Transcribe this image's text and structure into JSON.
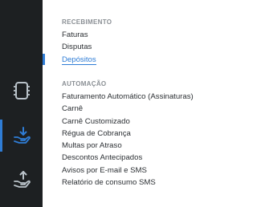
{
  "rail": {
    "items": [
      {
        "icon": "film-strip-icon",
        "active": false
      },
      {
        "icon": "hand-receive-icon",
        "active": true
      },
      {
        "icon": "hand-send-icon",
        "active": false
      }
    ]
  },
  "menu": {
    "sections": [
      {
        "title": "RECEBIMENTO",
        "items": [
          "Faturas",
          "Disputas",
          "Depósitos"
        ],
        "active_index": 2
      },
      {
        "title": "AUTOMAÇÃO",
        "items": [
          "Faturamento Automático (Assinaturas)",
          "Carnê",
          "Carnê Customizado",
          "Régua de Cobrança",
          "Multas por Atraso",
          "Descontos Antecipados",
          "Avisos por E-mail e SMS",
          "Relatório de consumo SMS"
        ]
      }
    ]
  },
  "colors": {
    "rail_bg": "#1d2022",
    "accent": "#2f7dd6",
    "icon": "#b9c2c9",
    "text": "#2b2f33",
    "section_title": "#8a8f94"
  }
}
